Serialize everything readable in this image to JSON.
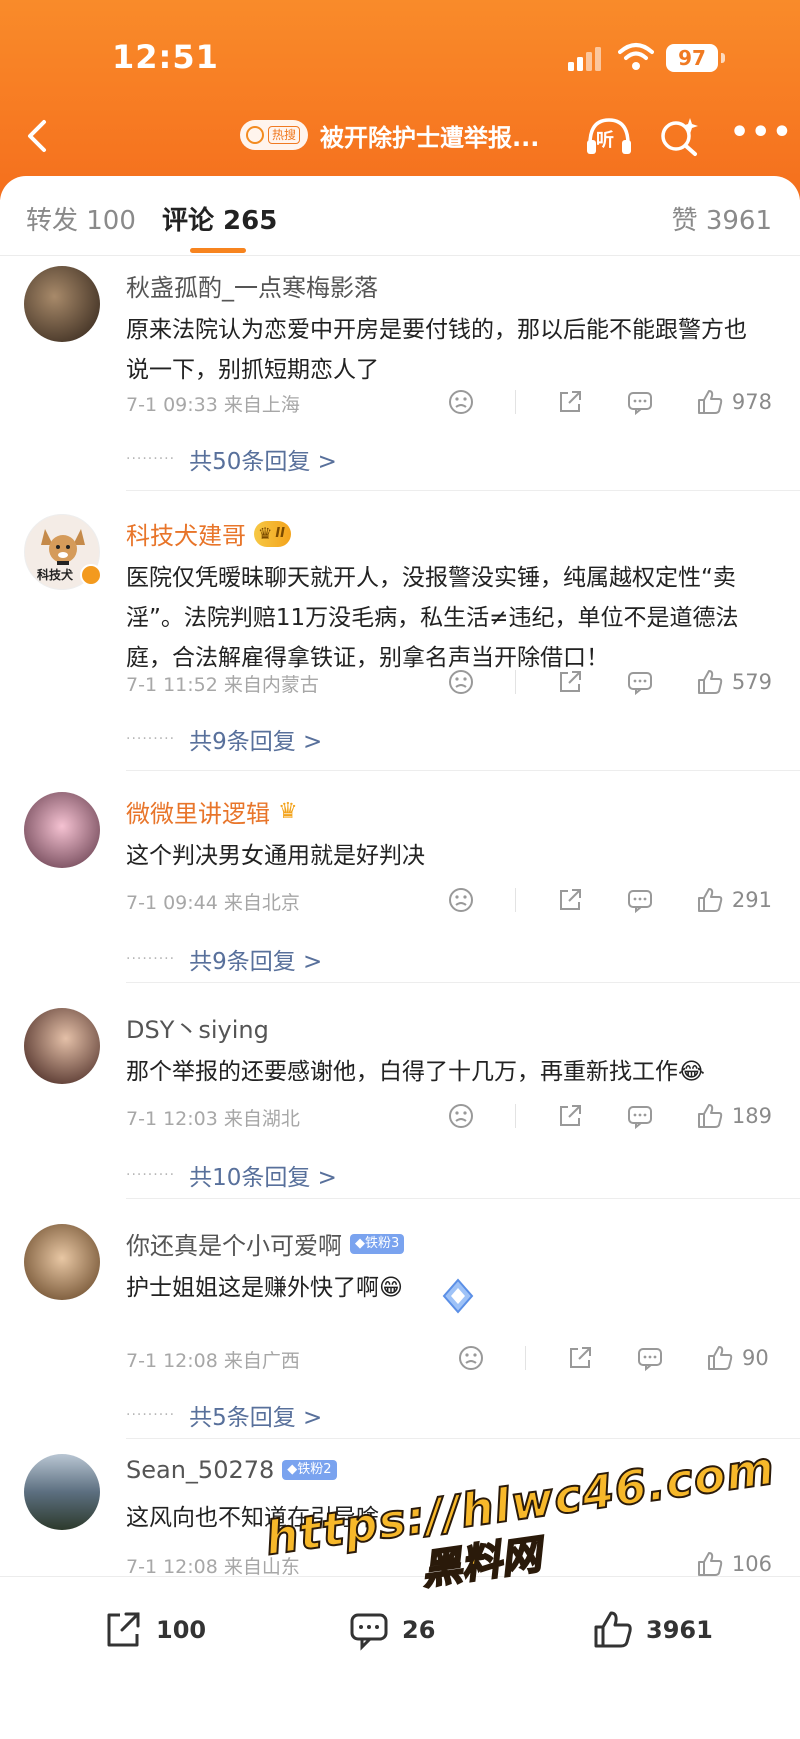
{
  "status_bar": {
    "time": "12:51",
    "battery": "97"
  },
  "navbar": {
    "hot_tag": "热搜",
    "title": "被开除护士遭举报...",
    "listen_label": "听"
  },
  "tabs": {
    "repost": "转发 100",
    "comments": "评论 265",
    "likes": "赞 3961"
  },
  "comments": [
    {
      "user": "秋盏孤酌_一点寒梅影落",
      "text": "原来法院认为恋爱中开房是要付钱的，那以后能不能跟警方也说一下，别抓短期恋人了",
      "meta": "7-1 09:33  来自上海",
      "likes": "978",
      "replies": "共50条回复 >",
      "avatar_color": "#6b5a4a"
    },
    {
      "user": "科技犬建哥",
      "badge": "II",
      "text": "医院仅凭暧昧聊天就开人，没报警没实锤，纯属越权定性“卖淫”。法院判赔11万没毛病，私生活≠违纪，单位不是道德法庭，合法解雇得拿铁证，别拿名声当开除借口！",
      "meta": "7-1 11:52  来自内蒙古",
      "likes": "579",
      "replies": "共9条回复 >",
      "avatar_color": "#f2e9e2"
    },
    {
      "user": "微微里讲逻辑",
      "text": "这个判决男女通用就是好判决",
      "meta": "7-1 09:44  来自北京",
      "likes": "291",
      "replies": "共9条回复 >",
      "avatar_color": "#e9b6c9"
    },
    {
      "user": "DSY丶siying",
      "text": "那个举报的还要感谢他，白得了十几万，再重新找工作😂",
      "meta": "7-1 12:03  来自湖北",
      "likes": "189",
      "replies": "共10条回复 >",
      "avatar_color": "#c98a83"
    },
    {
      "user": "你还真是个小可爱啊",
      "fan_badge": "◆铁粉3",
      "text": "护士姐姐这是赚外快了啊😁",
      "meta": "7-1 12:08  来自广西",
      "likes": "90",
      "replies": "共5条回复 >",
      "avatar_color": "#b48a6b"
    },
    {
      "user": "Sean_50278",
      "fan_badge": "◆铁粉2",
      "text": "这风向也不知道在引导啥",
      "meta": "7-1 12:08  来自山东",
      "likes": "106",
      "avatar_color": "#3f5a6e"
    }
  ],
  "bottom_bar": {
    "repost": "100",
    "comment": "26",
    "like": "3961"
  },
  "watermark": {
    "url": "https://hlwc46.com",
    "name": "黑料网"
  },
  "colors": {
    "accent": "#f77a22",
    "link": "#58709b",
    "orange_name": "#e8752a"
  }
}
